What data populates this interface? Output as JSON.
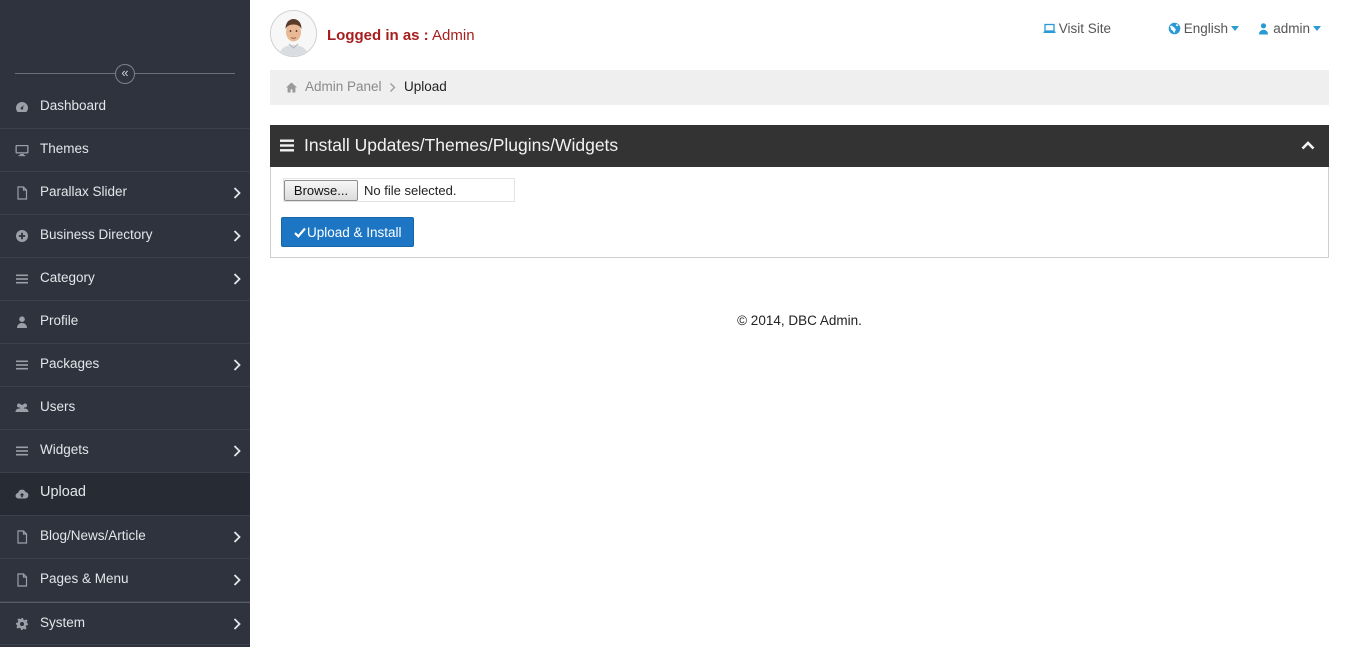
{
  "header": {
    "logged_label": "Logged in as :",
    "logged_user": "Admin",
    "visit_site": "Visit Site",
    "language": "English",
    "user_menu": "admin"
  },
  "sidebar": {
    "items": [
      {
        "label": "Dashboard",
        "icon": "dashboard-icon"
      },
      {
        "label": "Themes",
        "icon": "desktop-icon"
      },
      {
        "label": "Parallax Slider",
        "icon": "file-icon"
      },
      {
        "label": "Business Directory",
        "icon": "plus-circle-icon"
      },
      {
        "label": "Category",
        "icon": "list-icon"
      },
      {
        "label": "Profile",
        "icon": "user-icon"
      },
      {
        "label": "Packages",
        "icon": "list-icon"
      },
      {
        "label": "Users",
        "icon": "users-icon"
      },
      {
        "label": "Widgets",
        "icon": "list-icon"
      },
      {
        "label": "Upload",
        "icon": "cloud-upload-icon"
      },
      {
        "label": "Blog/News/Article",
        "icon": "file-icon"
      },
      {
        "label": "Pages & Menu",
        "icon": "file-icon"
      },
      {
        "label": "System",
        "icon": "gear-icon"
      }
    ],
    "active": "Upload"
  },
  "breadcrumb": {
    "root": "Admin Panel",
    "current": "Upload"
  },
  "panel": {
    "title": "Install Updates/Themes/Plugins/Widgets",
    "browse_label": "Browse...",
    "file_status": "No file selected.",
    "submit_label": "Upload & Install"
  },
  "footer": {
    "text": "© 2014, DBC Admin."
  },
  "colors": {
    "sidebar_bg": "#2e333d",
    "panel_header_bg": "#333333",
    "primary_button": "#1c76c3",
    "logged_text": "#a61e1e",
    "link_icon": "#2a9ad6"
  }
}
